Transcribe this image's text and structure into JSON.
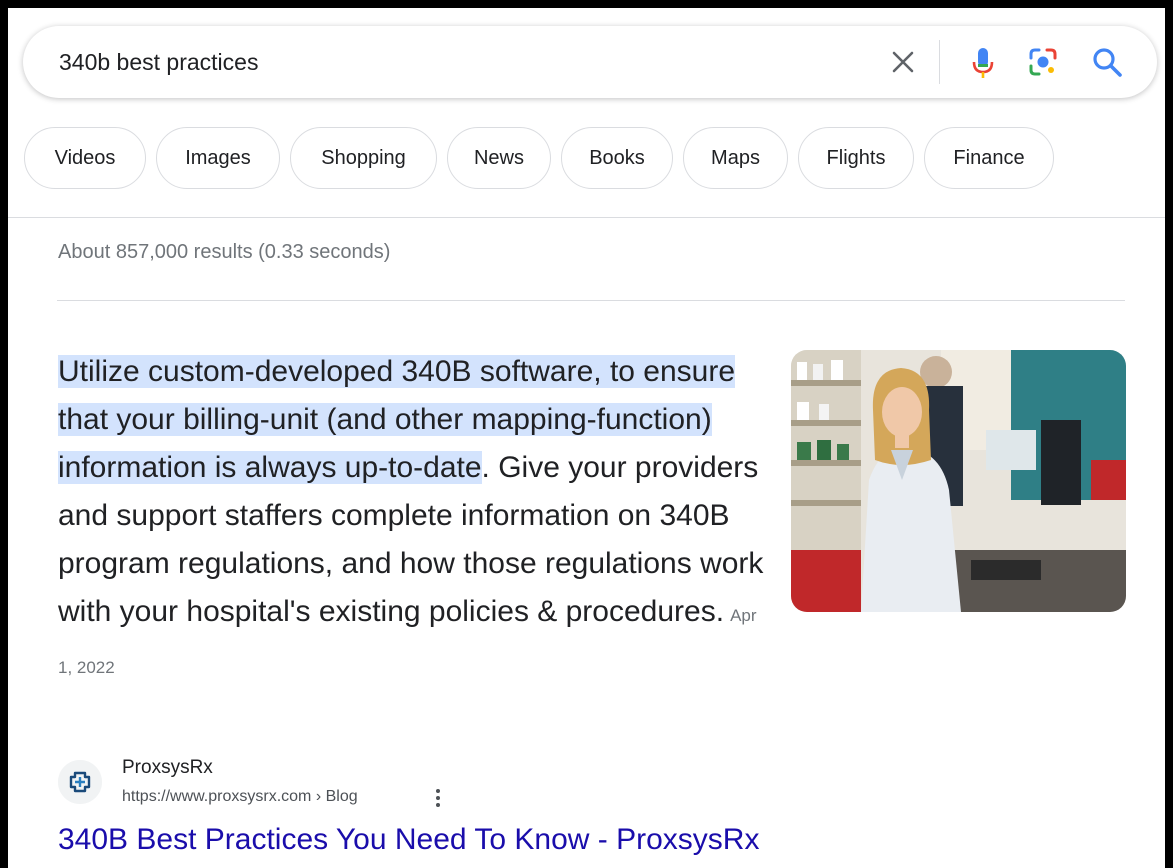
{
  "search": {
    "query": "340b best practices"
  },
  "chips": [
    "Videos",
    "Images",
    "Shopping",
    "News",
    "Books",
    "Maps",
    "Flights",
    "Finance"
  ],
  "results_stats": "About 857,000 results (0.33 seconds)",
  "featured_snippet": {
    "highlighted_text": "Utilize custom-developed 340B software, to ensure that your billing-unit (and other mapping-function) information is always up-to-date",
    "text": ". Give your providers and support staffers complete information on 340B program regulations, and how those regulations work with your hospital's existing policies & procedures.",
    "date": "Apr 1, 2022"
  },
  "source": {
    "site_name": "ProxsysRx",
    "url": "https://www.proxsysrx.com › Blog",
    "title": "340B Best Practices You Need To Know - ProxsysRx"
  },
  "colors": {
    "link": "#1a0dab",
    "highlight": "#d3e3fd",
    "secondary_text": "#70757a"
  }
}
